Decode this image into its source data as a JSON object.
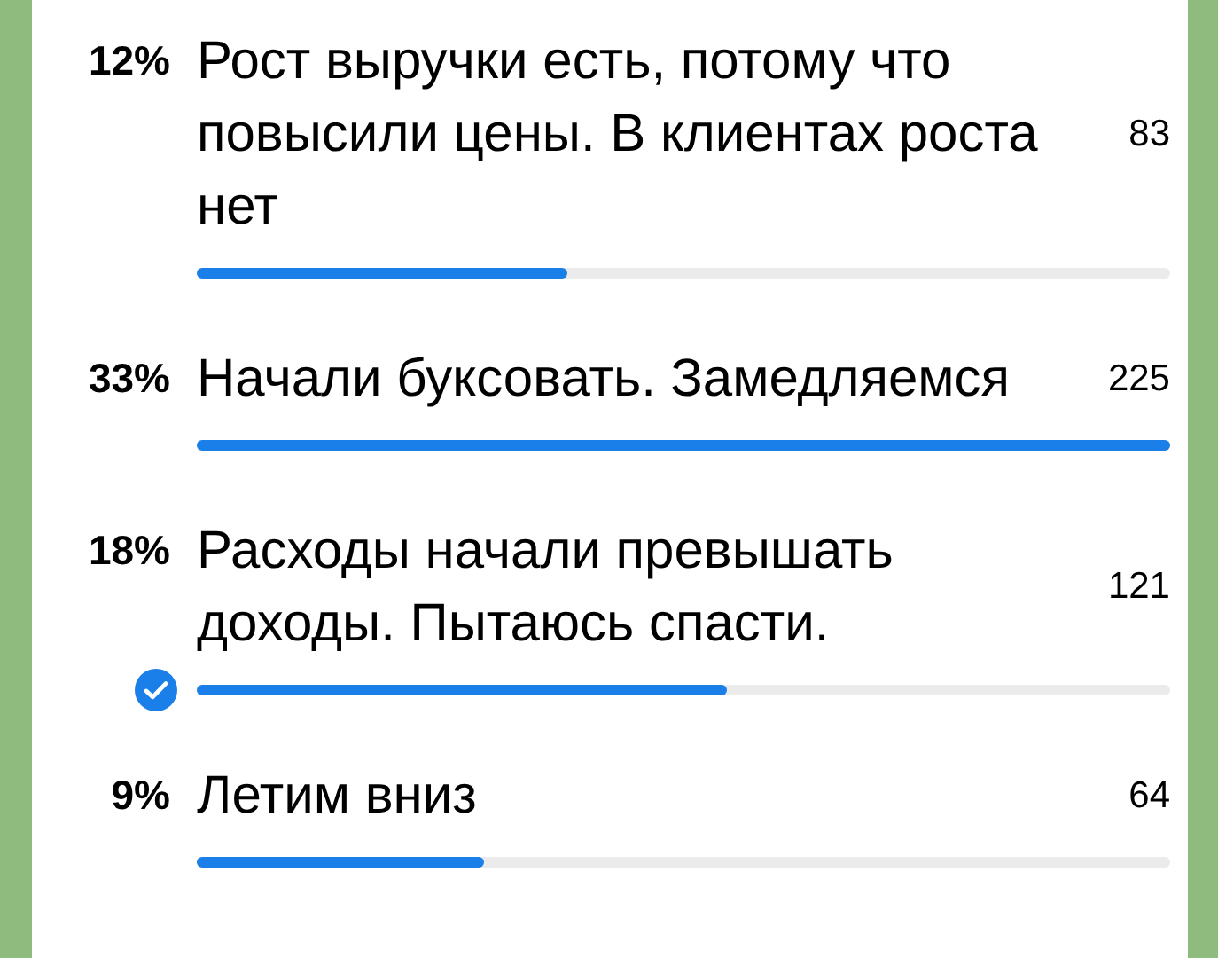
{
  "poll": {
    "options": [
      {
        "percent": "12%",
        "text": "Рост выручки есть, потому что повысили цены. В клиентах роста нет",
        "votes": "83",
        "level": 0.38,
        "selected": false
      },
      {
        "percent": "33%",
        "text": "Начали буксовать. Замедляемся",
        "votes": "225",
        "level": 1.0,
        "selected": false
      },
      {
        "percent": "18%",
        "text": "Расходы начали превышать доходы. Пытаюсь спасти.",
        "votes": "121",
        "level": 0.545,
        "selected": true
      },
      {
        "percent": "9%",
        "text": "Летим вниз",
        "votes": "64",
        "level": 0.295,
        "selected": false
      }
    ]
  }
}
